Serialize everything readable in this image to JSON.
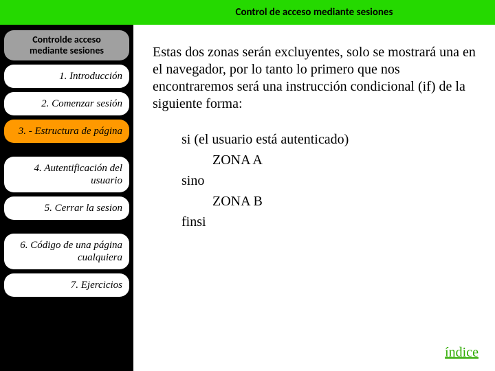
{
  "header": {
    "title": "Control de acceso mediante sesiones"
  },
  "sidebar": {
    "title_line1": "Controlde acceso",
    "title_line2": "mediante sesiones",
    "items": [
      {
        "label": "1. Introducción",
        "active": false
      },
      {
        "label": "2. Comenzar sesión",
        "active": false
      },
      {
        "label": "3. - Estructura de página",
        "active": true
      },
      {
        "label": "4. Autentificación del usuario",
        "active": false
      },
      {
        "label": "5. Cerrar la sesion",
        "active": false
      },
      {
        "label": "6. Código de una página cualquiera",
        "active": false
      },
      {
        "label": "7. Ejercicios",
        "active": false
      }
    ]
  },
  "content": {
    "paragraph": "Estas dos zonas serán excluyentes, solo se mostrará una en el navegador, por lo tanto lo primero que nos encontraremos será una instrucción condicional (if) de la siguiente forma:",
    "pseudo_line1": "si (el usuario está autenticado)",
    "pseudo_line2": "         ZONA A",
    "pseudo_line3": "sino",
    "pseudo_line4": "         ZONA B",
    "pseudo_line5": "finsi",
    "index_label": "índice"
  }
}
